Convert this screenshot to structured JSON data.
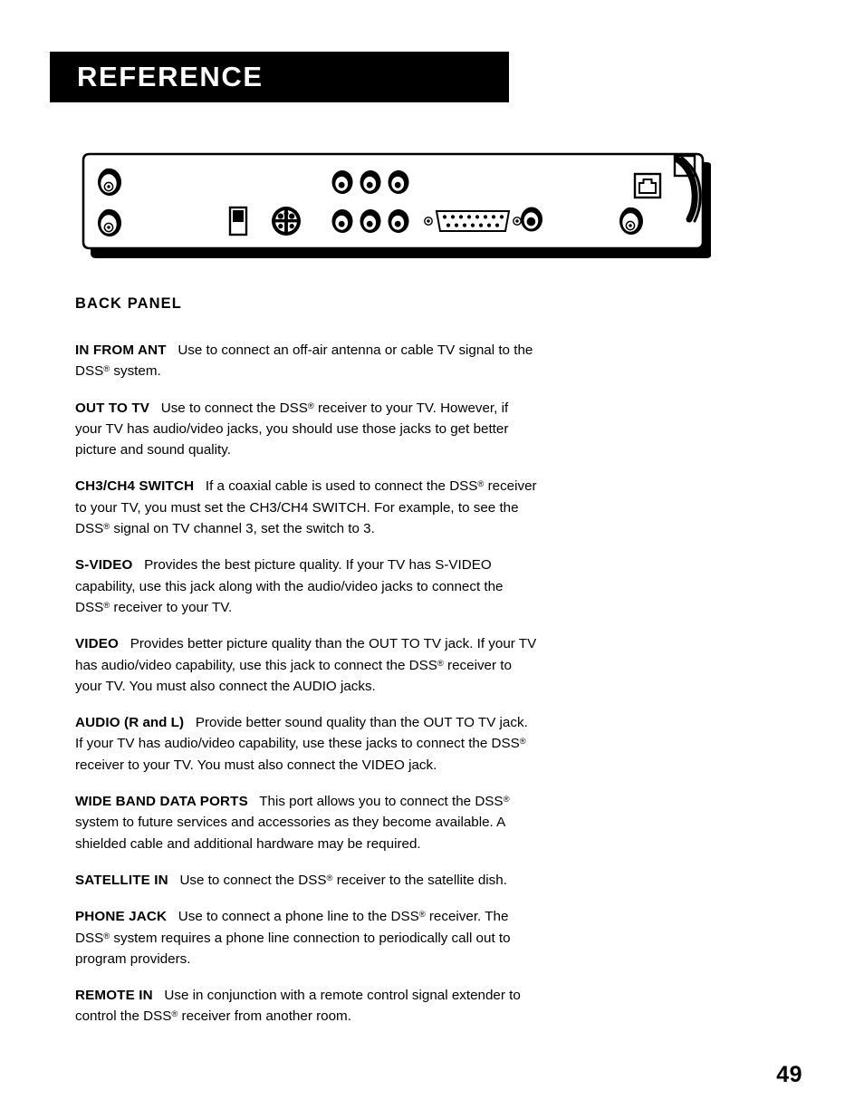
{
  "header": {
    "title": "REFERENCE"
  },
  "figure": {
    "caption_name": "back-panel-illustration",
    "connectors": [
      "in-from-ant-f-connector",
      "out-to-tv-f-connector",
      "ch3-ch4-switch",
      "s-video-jack",
      "video-rca-jack-top",
      "audio-r-rca-jack-top",
      "audio-l-rca-jack-top",
      "video-rca-jack-bottom",
      "audio-r-rca-jack-bottom",
      "audio-l-rca-jack-bottom",
      "wide-band-data-port",
      "remote-in-jack",
      "satellite-in-f-connector",
      "phone-jack",
      "phone-cord"
    ]
  },
  "content": {
    "heading": "BACK PANEL",
    "paragraphs": [
      {
        "term": "IN FROM ANT",
        "term_suffix": "",
        "body_1": "Use to connect an off-air antenna or cable TV signal to the DSS",
        "body_2": " system."
      },
      {
        "term": "OUT TO TV",
        "term_suffix": "",
        "body_1": "Use to connect the DSS",
        "body_2": " receiver to your TV.   However, if your TV has audio/video jacks, you should use those jacks to get better picture and sound quality."
      },
      {
        "term": "CH3/CH4 SWITCH",
        "term_suffix": "",
        "body_1": "If a coaxial cable is used to connect the DSS",
        "body_2": " receiver to your TV, you must set the CH3/CH4 SWITCH.   For example, to see the DSS",
        "body_3": " signal on TV channel 3, set the switch to 3."
      },
      {
        "term": "S-VIDEO",
        "term_suffix": "",
        "body_1": "Provides the best picture quality.  If your TV has S-VIDEO capability, use this jack along with the audio/video jacks to connect the DSS",
        "body_2": " receiver to your TV."
      },
      {
        "term": "VIDEO",
        "term_suffix": "",
        "body_1": "Provides better picture quality than the OUT TO TV jack.  If your TV has audio/video capability, use this jack to connect the DSS",
        "body_2": " receiver to your TV. You must also connect the AUDIO jacks."
      },
      {
        "term": "AUDIO (",
        "term_suffix": "R and L",
        "term_close": ")",
        "body_1": "Provide better sound quality than the OUT TO TV jack.  If your TV has audio/video capability, use these jacks to connect the DSS",
        "body_2": " receiver to your TV. You must also connect the VIDEO jack."
      },
      {
        "term": "WIDE BAND DATA PORTS",
        "term_suffix": "",
        "body_1": "This port allows you to connect the DSS",
        "body_2": " system to future services and accessories as they become available.  A shielded cable and additional hardware may be required."
      },
      {
        "term": "SATELLITE IN",
        "term_suffix": "",
        "body_1": "Use to connect the DSS",
        "body_2": " receiver to the satellite dish."
      },
      {
        "term": "PHONE JACK",
        "term_suffix": "",
        "body_1": "Use to connect a phone line to the DSS",
        "body_2": " receiver. The DSS",
        "body_3": " system requires a phone line connection to periodically call out to program providers."
      },
      {
        "term": "REMOTE IN",
        "term_suffix": "",
        "body_1": "Use in conjunction with a remote control signal extender to control the DSS",
        "body_2": " receiver from another room."
      }
    ],
    "registered_mark": "®"
  },
  "footer": {
    "page_number": "49"
  },
  "colors": {
    "ink": "#000000",
    "paper": "#ffffff",
    "banner": "#000000",
    "banner_text": "#ffffff"
  }
}
